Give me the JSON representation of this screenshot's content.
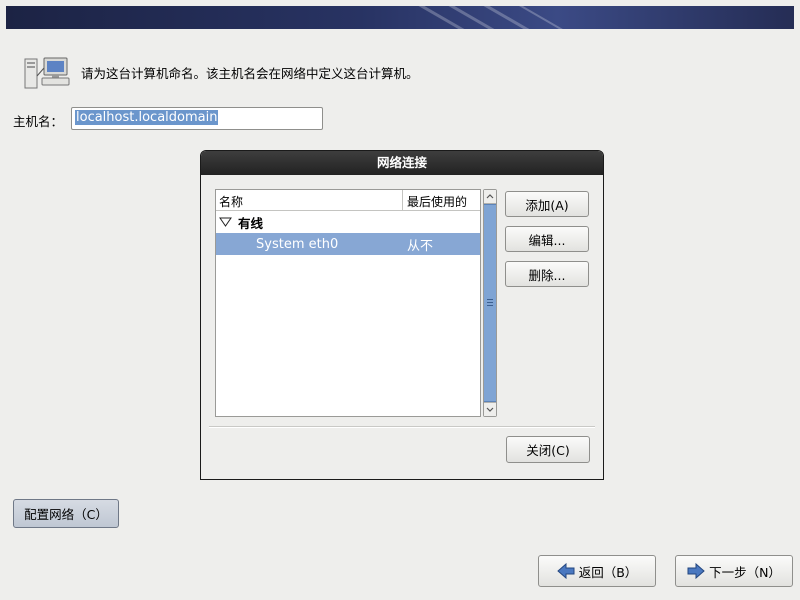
{
  "intro_text": "请为这台计算机命名。该主机名会在网络中定义这台计算机。",
  "hostname": {
    "label": "主机名：",
    "value": "localhost.localdomain"
  },
  "dialog": {
    "title": "网络连接",
    "columns": {
      "name": "名称",
      "last_used": "最后使用的"
    },
    "group": "有线",
    "connection": {
      "name": "System eth0",
      "last_used": "从不"
    },
    "buttons": {
      "add": "添加(A)",
      "edit": "编辑...",
      "delete": "删除...",
      "close": "关闭(C)"
    }
  },
  "configure_network_button": "配置网络（C）",
  "nav": {
    "back": "返回（B）",
    "next": "下一步（N）"
  },
  "colors": {
    "selection": "#87a7d4",
    "banner": "#283363"
  }
}
